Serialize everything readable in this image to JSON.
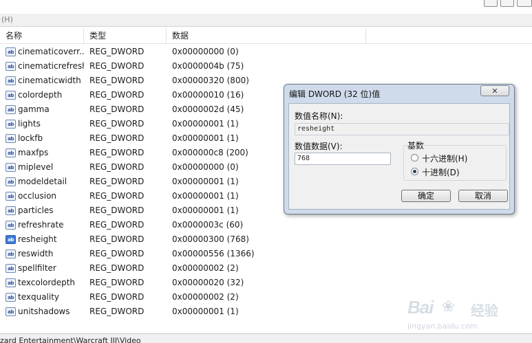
{
  "menu": {
    "partial_label": "(H)"
  },
  "columns": {
    "name": "名称",
    "type": "类型",
    "data": "数据"
  },
  "rows": [
    {
      "name": "cinematicoverr...",
      "type": "REG_DWORD",
      "data": "0x00000000 (0)"
    },
    {
      "name": "cinematicrefresh",
      "type": "REG_DWORD",
      "data": "0x0000004b (75)"
    },
    {
      "name": "cinematicwidth",
      "type": "REG_DWORD",
      "data": "0x00000320 (800)"
    },
    {
      "name": "colordepth",
      "type": "REG_DWORD",
      "data": "0x00000010 (16)"
    },
    {
      "name": "gamma",
      "type": "REG_DWORD",
      "data": "0x0000002d (45)"
    },
    {
      "name": "lights",
      "type": "REG_DWORD",
      "data": "0x00000001 (1)"
    },
    {
      "name": "lockfb",
      "type": "REG_DWORD",
      "data": "0x00000001 (1)"
    },
    {
      "name": "maxfps",
      "type": "REG_DWORD",
      "data": "0x000000c8 (200)"
    },
    {
      "name": "miplevel",
      "type": "REG_DWORD",
      "data": "0x00000000 (0)"
    },
    {
      "name": "modeldetail",
      "type": "REG_DWORD",
      "data": "0x00000001 (1)"
    },
    {
      "name": "occlusion",
      "type": "REG_DWORD",
      "data": "0x00000001 (1)"
    },
    {
      "name": "particles",
      "type": "REG_DWORD",
      "data": "0x00000001 (1)"
    },
    {
      "name": "refreshrate",
      "type": "REG_DWORD",
      "data": "0x0000003c (60)"
    },
    {
      "name": "resheight",
      "type": "REG_DWORD",
      "data": "0x00000300 (768)",
      "selected": true
    },
    {
      "name": "reswidth",
      "type": "REG_DWORD",
      "data": "0x00000556 (1366)"
    },
    {
      "name": "spellfilter",
      "type": "REG_DWORD",
      "data": "0x00000002 (2)"
    },
    {
      "name": "texcolordepth",
      "type": "REG_DWORD",
      "data": "0x00000020 (32)"
    },
    {
      "name": "texquality",
      "type": "REG_DWORD",
      "data": "0x00000002 (2)"
    },
    {
      "name": "unitshadows",
      "type": "REG_DWORD",
      "data": "0x00000001 (1)"
    }
  ],
  "row_icon_text": "ab",
  "statusbar": {
    "path": "zard Entertainment\\Warcraft III\\Video"
  },
  "dialog": {
    "title": "编辑 DWORD (32 位)值",
    "name_label": "数值名称(N):",
    "name_value": "resheight",
    "data_label": "数值数据(V):",
    "data_value": "768",
    "base_label": "基数",
    "radio_hex": "十六进制(H)",
    "radio_dec": "十进制(D)",
    "base_selected": "decimal",
    "ok": "确定",
    "cancel": "取消"
  },
  "watermark": {
    "brand_left": "Bai",
    "brand_right": "经验",
    "url": "jingyan.baidu.com"
  }
}
